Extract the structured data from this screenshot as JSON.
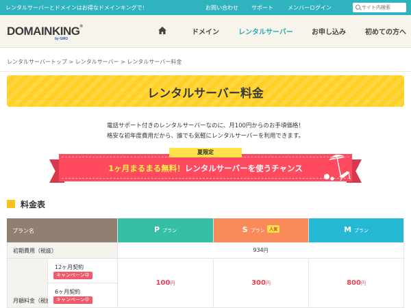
{
  "topbar": {
    "tagline": "レンタルサーバーとドメインはお得なドメインキングで！",
    "links": [
      "お問い合わせ",
      "サポート",
      "メンバーログイン"
    ],
    "search_placeholder": "サイト内検索"
  },
  "header": {
    "logo": "DOMAINKING",
    "logo_reg": "®",
    "logo_sub": "by GMO",
    "nav": [
      "ドメイン",
      "レンタルサーバー",
      "お申し込み",
      "初めての方へ"
    ],
    "active_nav": "レンタルサーバー"
  },
  "breadcrumb": "レンタルサーバートップ > レンタルサーバー > レンタルサーバー料金",
  "page_title": "レンタルサーバー料金",
  "intro": [
    "電話サポート付きのレンタルサーバーなのに、月100円からのお手頃価格！",
    "格安な初年度費用だから、誰でも気軽にレンタルサーバーを利用できます。"
  ],
  "campaign": {
    "badge": "夏限定",
    "text_before": "1ヶ月まるまる",
    "text_highlight": "無料！",
    "text_after": "レンタルサーバーを使うチャンス"
  },
  "section_title": "料金表",
  "table": {
    "plan_col_label": "プラン名",
    "plans": [
      {
        "letter": "P",
        "suffix": "プラン",
        "badge": ""
      },
      {
        "letter": "S",
        "suffix": "プラン",
        "badge": "人気"
      },
      {
        "letter": "M",
        "suffix": "プラン",
        "badge": ""
      }
    ],
    "initial_label": "初期費用（税抜）",
    "initial_value": "934",
    "yen": "円",
    "monthly_label": "月額料金（税抜",
    "contracts": [
      {
        "label": "12ヶ月契約",
        "tag": "キャンペーン中"
      },
      {
        "label": "6ヶ月契約",
        "tag": "キャンペーン中"
      }
    ],
    "monthly_prices": [
      "100",
      "300",
      "800"
    ]
  },
  "colors": {
    "topbar": "#2fb4bf",
    "accent": "#2aacb6",
    "title_yellow": "#ffd83f",
    "ribbon_red": "#ff4a5f",
    "plan_p": "#35c0a6",
    "plan_s": "#f98a5a",
    "plan_m": "#25b8d2",
    "price_red": "#e83d55"
  }
}
